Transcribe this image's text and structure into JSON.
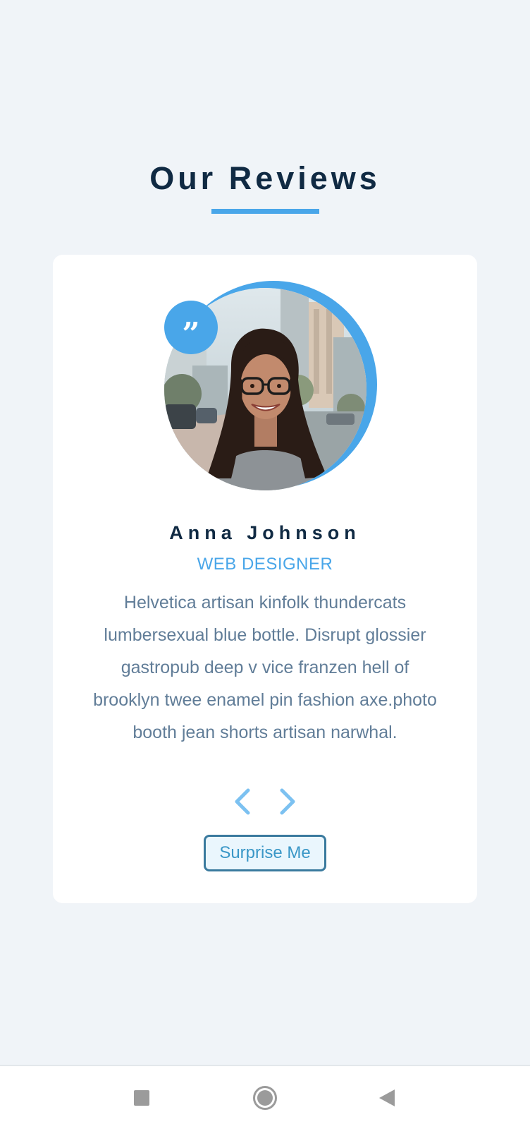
{
  "header": {
    "title": "Our Reviews"
  },
  "review": {
    "name": "Anna Johnson",
    "job": "WEB DESIGNER",
    "text": "Helvetica artisan kinfolk thundercats lumbersexual blue bottle. Disrupt glossier gastropub deep v vice franzen hell of brooklyn twee enamel pin fashion axe.photo booth jean shorts artisan narwhal.",
    "quote_icon": "quote-icon",
    "quote_glyph": "”"
  },
  "controls": {
    "prev_icon": "chevron-left-icon",
    "next_icon": "chevron-right-icon",
    "surprise_label": "Surprise Me"
  },
  "system_nav": {
    "recents_icon": "square-icon",
    "home_icon": "circle-icon",
    "back_icon": "triangle-back-icon"
  },
  "colors": {
    "background": "#f0f4f8",
    "primary": "#49a6e9",
    "title": "#102a43",
    "text": "#617d98",
    "card": "#ffffff"
  }
}
